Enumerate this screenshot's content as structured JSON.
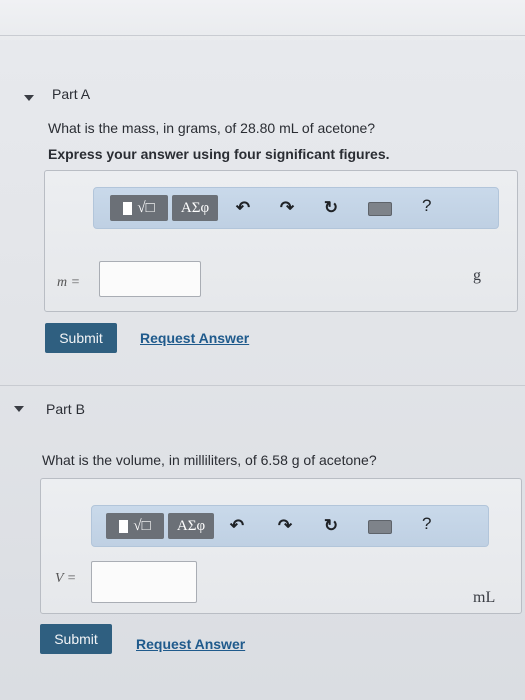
{
  "part_a": {
    "label": "Part A",
    "question": "What is the mass, in grams, of 28.80 mL of acetone?",
    "instruction": "Express your answer using four significant figures.",
    "variable": "m =",
    "answer_value": "",
    "unit": "g",
    "submit_label": "Submit",
    "request_label": "Request Answer"
  },
  "part_b": {
    "label": "Part B",
    "question": "What is the volume, in milliliters, of 6.58 g of acetone?",
    "variable": "V =",
    "answer_value": "",
    "unit": "mL",
    "submit_label": "Submit",
    "request_label": "Request Answer"
  },
  "toolbar": {
    "template_label": "√□",
    "greek_label": "ΑΣφ",
    "help_label": "?",
    "icons": [
      "undo-icon",
      "redo-icon",
      "reset-icon",
      "keyboard-icon",
      "help-icon"
    ]
  },
  "colors": {
    "submit_bg": "#2f5f80",
    "toolbar_bg": "#c4d5e7",
    "link": "#1f5a8c"
  }
}
